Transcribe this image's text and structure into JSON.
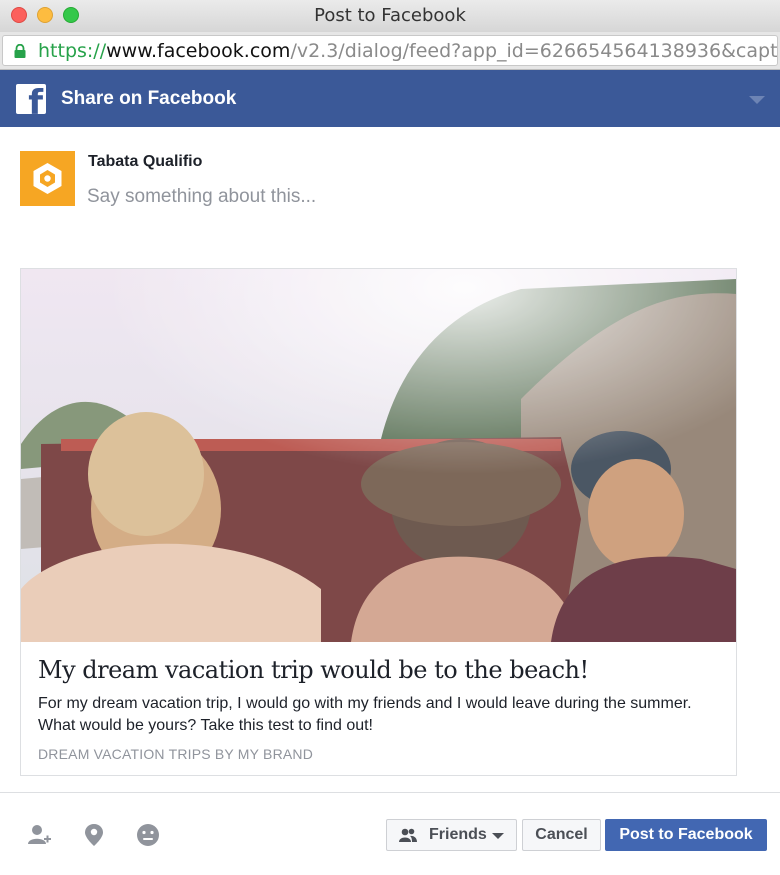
{
  "window": {
    "title": "Post to Facebook"
  },
  "address_bar": {
    "scheme": "https://",
    "domain": "www.facebook.com",
    "path": "/v2.3/dialog/feed?app_id=626654564138936&captio…"
  },
  "header": {
    "logo_letter": "f",
    "title": "Share on Facebook",
    "chevron_icon": "chevron-down-icon"
  },
  "composer": {
    "user_name": "Tabata Qualifio",
    "placeholder": "Say something about this...",
    "avatar_color": "#f6a623"
  },
  "link_preview": {
    "title": "My dream vacation trip would be to the beach!",
    "description": "For my dream vacation trip, I would go with my friends and I would leave during the summer. What would be yours? Take this test to find out!",
    "source": "DREAM VACATION TRIPS BY MY BRAND",
    "image_alt": "friends in a convertible car"
  },
  "footer": {
    "icons": [
      "tag-friends-icon",
      "location-pin-icon",
      "feeling-emoji-icon"
    ],
    "audience_label": "Friends",
    "cancel_label": "Cancel",
    "post_label": "Post to Facebook"
  },
  "colors": {
    "facebook_blue": "#3b5998",
    "post_button": "#4267b2",
    "muted_text": "#90949c"
  }
}
